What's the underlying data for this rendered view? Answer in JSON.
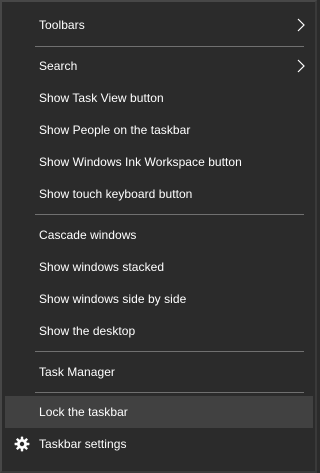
{
  "menu": {
    "toolbars": "Toolbars",
    "search": "Search",
    "task_view": "Show Task View button",
    "people": "Show People on the taskbar",
    "ink_workspace": "Show Windows Ink Workspace button",
    "touch_keyboard": "Show touch keyboard button",
    "cascade": "Cascade windows",
    "stacked": "Show windows stacked",
    "side_by_side": "Show windows side by side",
    "desktop": "Show the desktop",
    "task_manager": "Task Manager",
    "lock_taskbar": "Lock the taskbar",
    "taskbar_settings": "Taskbar settings"
  },
  "icons": {
    "submenu": "chevron-right-icon",
    "settings": "gear-icon"
  },
  "colors": {
    "background": "#2b2b2b",
    "hover": "#414141",
    "separator": "#707070",
    "text": "#ffffff"
  }
}
